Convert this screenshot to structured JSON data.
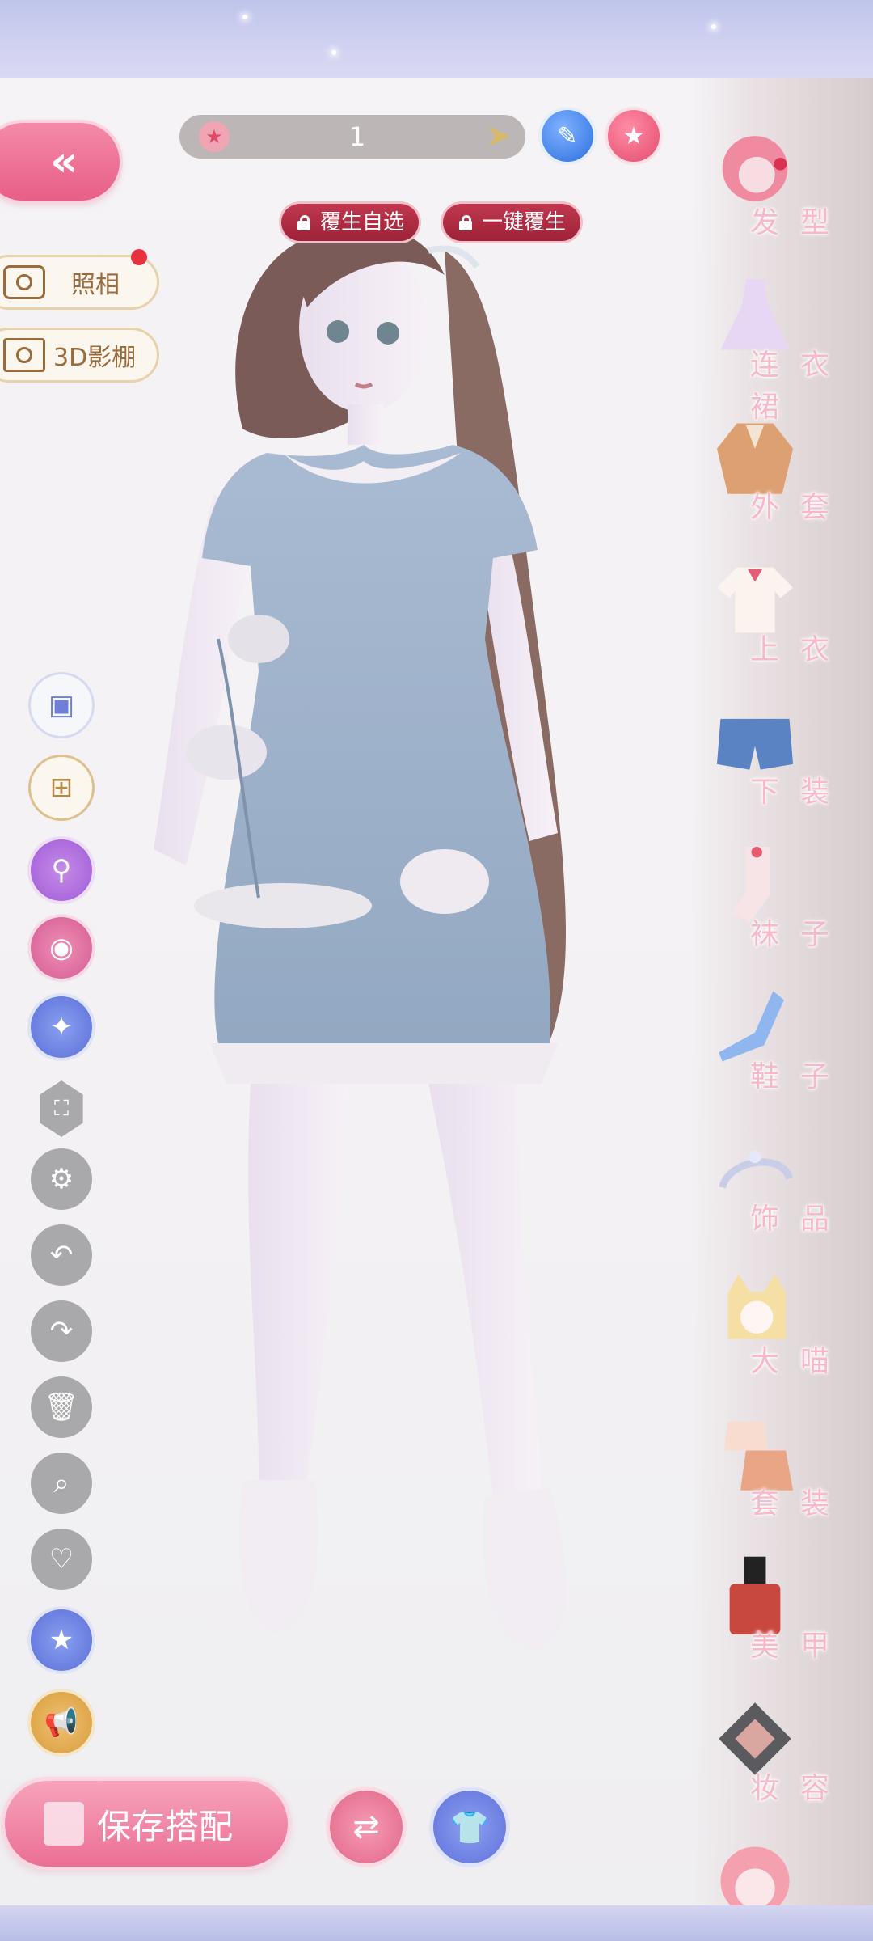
{
  "header": {
    "back_icon": "double-chevron-left-icon",
    "currency_value": "1",
    "currency_icon": "star-coin-icon",
    "rebirth_select_label": "覆生自选",
    "one_click_rebirth_label": "一键覆生"
  },
  "side_actions": {
    "photo_label": "照相",
    "studio_label": "3D影棚"
  },
  "tools": [
    {
      "name": "wardrobe-icon"
    },
    {
      "name": "copy-add-icon"
    },
    {
      "name": "search-sparkle-icon"
    },
    {
      "name": "palette-icon"
    },
    {
      "name": "magic-star-icon"
    },
    {
      "name": "fullscreen-icon"
    },
    {
      "name": "gear-icon"
    },
    {
      "name": "undo-icon"
    },
    {
      "name": "redo-icon"
    },
    {
      "name": "trash-icon"
    },
    {
      "name": "search-icon"
    },
    {
      "name": "heart-icon"
    },
    {
      "name": "star-badge-icon"
    },
    {
      "name": "megaphone-icon"
    }
  ],
  "categories": [
    {
      "label": "发型"
    },
    {
      "label": "连衣裙"
    },
    {
      "label": "外套"
    },
    {
      "label": "上衣"
    },
    {
      "label": "下装"
    },
    {
      "label": "袜子"
    },
    {
      "label": "鞋子"
    },
    {
      "label": "饰品"
    },
    {
      "label": "大喵"
    },
    {
      "label": "套装"
    },
    {
      "label": "美甲"
    },
    {
      "label": "妆容"
    }
  ],
  "bottom": {
    "save_label": "保存搭配"
  },
  "colors": {
    "accent_pink": "#eb6f95",
    "accent_blue": "#5e70d9",
    "dress_blue": "#9fb2cb",
    "label_pink": "#f7b8c7"
  }
}
